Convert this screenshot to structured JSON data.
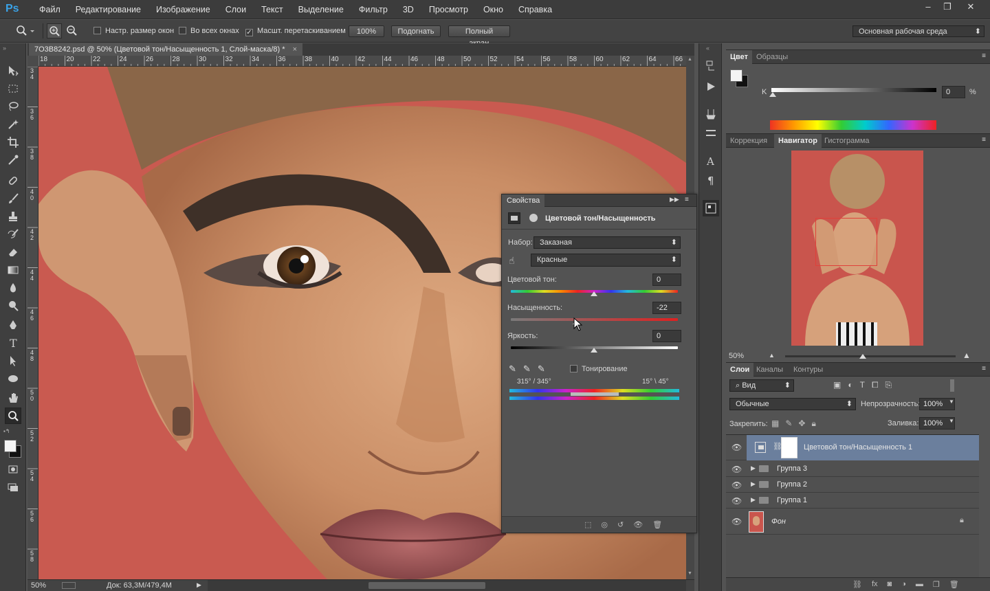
{
  "app": {
    "logo": "Ps"
  },
  "menu": [
    "Файл",
    "Редактирование",
    "Изображение",
    "Слои",
    "Текст",
    "Выделение",
    "Фильтр",
    "3D",
    "Просмотр",
    "Окно",
    "Справка"
  ],
  "window_controls": {
    "minimize": "–",
    "restore": "❐",
    "close": "✕"
  },
  "options_bar": {
    "resize_windows": "Настр. размер окон",
    "all_windows": "Во всех окнах",
    "scrubby_zoom": "Масшт. перетаскиванием",
    "zoom_100": "100%",
    "fit": "Подогнать",
    "full_screen": "Полный экран",
    "workspace": "Основная рабочая среда"
  },
  "document_tab": {
    "title": "7O3B8242.psd @ 50% (Цветовой тон/Насыщенность 1, Слой-маска/8) *",
    "close": "×"
  },
  "rulers": {
    "h": [
      "18",
      "20",
      "22",
      "24",
      "26",
      "28",
      "30",
      "32",
      "34",
      "36",
      "38",
      "40",
      "42",
      "44",
      "46",
      "48",
      "50",
      "52",
      "54",
      "56",
      "58",
      "60",
      "62",
      "64",
      "66"
    ],
    "v": [
      "34",
      "36",
      "38",
      "40",
      "42",
      "44",
      "46",
      "48",
      "50",
      "52",
      "54",
      "56",
      "58"
    ]
  },
  "status": {
    "zoom": "50%",
    "doc": "Док: 63,3M/479,4M"
  },
  "color_panel": {
    "tabs": [
      "Цвет",
      "Образцы"
    ],
    "channel": "K",
    "value": "0",
    "unit": "%"
  },
  "navigator_panel": {
    "tabs": [
      "Коррекция",
      "Навигатор",
      "Гистограмма"
    ],
    "zoom": "50%"
  },
  "properties": {
    "tab": "Свойства",
    "title": "Цветовой тон/Насыщенность",
    "preset_label": "Набор:",
    "preset_value": "Заказная",
    "channel_value": "Красные",
    "hue_label": "Цветовой тон:",
    "hue_value": "0",
    "saturation_label": "Насыщенность:",
    "saturation_value": "-22",
    "lightness_label": "Яркость:",
    "lightness_value": "0",
    "colorize_label": "Тонирование",
    "range_left": "315° / 345°",
    "range_right": "15° \\ 45°"
  },
  "layers_panel": {
    "tabs": [
      "Слои",
      "Каналы",
      "Контуры"
    ],
    "filter": "Вид",
    "blend_mode": "Обычные",
    "opacity_label": "Непрозрачность:",
    "opacity_value": "100%",
    "lock_label": "Закрепить:",
    "fill_label": "Заливка:",
    "fill_value": "100%",
    "layers": [
      {
        "name": "Цветовой тон/Насыщенность 1"
      },
      {
        "name": "Группа 3"
      },
      {
        "name": "Группа 2"
      },
      {
        "name": "Группа 1"
      },
      {
        "name": "Фон"
      }
    ]
  },
  "colors": {
    "accent_selected_layer": "#6b7f9d",
    "nav_box": "#e0403a",
    "ps_blue": "#3aa3e8"
  }
}
